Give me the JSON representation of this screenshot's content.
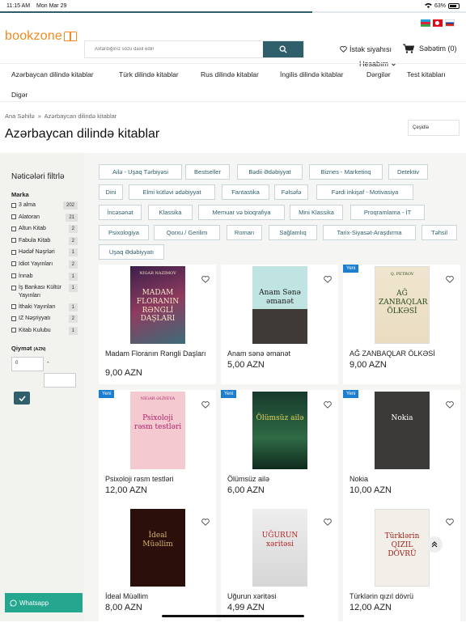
{
  "status": {
    "time": "11:15 AM",
    "date": "Mon Mar 29",
    "battery": "63%"
  },
  "header": {
    "logo": "bookzone",
    "search_placeholder": "Axtardığınız sözü daxil edin",
    "wishlist": "İstək siyahısı",
    "cart": "Səbətim (0)",
    "account": "Hesabım"
  },
  "nav": [
    "Azərbaycan dilində kitablar",
    "Türk dilində kitablar",
    "Rus dilində kitablar",
    "İngilis dilində kitablar",
    "Dərgilər",
    "Test kitabları",
    "Digər"
  ],
  "breadcrumb": {
    "home": "Ana Səhifə",
    "sep": "»",
    "current": "Azərbaycan dilində kitablar"
  },
  "page_title": "Azərbaycan dilində kitablar",
  "sort_label": "Çeşidlə",
  "filters": {
    "title": "Nəticələri filtrlə",
    "brand_label": "Marka",
    "brands": [
      {
        "name": "3 alma",
        "count": "202"
      },
      {
        "name": "Alatoran",
        "count": "21"
      },
      {
        "name": "Altun Kitab",
        "count": "2"
      },
      {
        "name": "Fabula Kitab",
        "count": "2"
      },
      {
        "name": "Hədəf Nəşrləri",
        "count": "1"
      },
      {
        "name": "Idiot Yayınları",
        "count": "2"
      },
      {
        "name": "İnnab",
        "count": "1"
      },
      {
        "name": "İş Bankası Kültür Yayınları",
        "count": "1"
      },
      {
        "name": "İthaki Yayınları",
        "count": "1"
      },
      {
        "name": "IZ Nəşriyyatı",
        "count": "2"
      },
      {
        "name": "Kitab Kulubu",
        "count": "1"
      }
    ],
    "price_label": "Qiymət",
    "price_unit": "(AZN)",
    "price_min": "0",
    "dash": "-"
  },
  "tags": [
    "Ailə - Uşaq Tərbiyəsi",
    "Bestseller",
    "Bədii Ədəbiyyat",
    "Biznes - Marketinq",
    "Detektiv",
    "Dini",
    "Elmi kütləvi ədəbiyyat",
    "Fantastika",
    "Fəlsəfə",
    "Fərdi inkişaf - Motivasiya",
    "İncəsənət",
    "Klassika",
    "Memuar və bioqrafiya",
    "Mini Klassika",
    "Proqramlama - İT",
    "Psixologiya",
    "Qorxu / Gerilim",
    "Roman",
    "Sağlamlıq",
    "Tarix-Siyasət-Araşdırma",
    "Təhsil",
    "Uşaq Ədəbiyyatı"
  ],
  "new_badge": "Yeni",
  "products": [
    {
      "title": "Madam Floranın Rəngli Daşları",
      "price": "9,00 AZN",
      "new": false,
      "cover_top": "NIGAR NAZIMOV",
      "cover_main": "MADAM FLORANIN RƏNGLİ DAŞLARI"
    },
    {
      "title": "Anam sənə əmanət",
      "price": "5,00 AZN",
      "new": false,
      "cover_main": "Anam Sənə əmanət"
    },
    {
      "title": "AĞ ZANBAQLAR ÖLKƏSİ",
      "price": "9,00 AZN",
      "new": true,
      "cover_top": "Q. PETROV",
      "cover_main": "AĞ ZANBAQLAR ÖLKƏSİ"
    },
    {
      "title": "Psixoloji rəsm testləri",
      "price": "12,00 AZN",
      "new": true,
      "cover_top": "NİGAR ƏLİYEVA",
      "cover_main": "Psixoloji rəsm testləri"
    },
    {
      "title": "Ölümsüz ailə",
      "price": "6,00 AZN",
      "new": true,
      "cover_main": "Ölümsüz ailə"
    },
    {
      "title": "Nokia",
      "price": "10,00 AZN",
      "new": true,
      "cover_main": "Nokia"
    },
    {
      "title": "İdeal Müəllim",
      "price": "8,00 AZN",
      "new": false,
      "cover_main": "İdeal Müəllim"
    },
    {
      "title": "Uğurun xəritəsi",
      "price": "4,99 AZN",
      "new": false,
      "cover_main": "UĞURUN xəritəsi"
    },
    {
      "title": "Türklərin qızıl dövrü",
      "price": "12,00 AZN",
      "new": false,
      "cover_main": "Türklərin QIZIL DÖVRÜ"
    }
  ],
  "whatsapp": "Whatsapp",
  "colors": {
    "accent": "#2e5f6b",
    "brand": "#f28a1f",
    "badge": "#1c7ecf",
    "whatsapp": "#25a68f"
  }
}
